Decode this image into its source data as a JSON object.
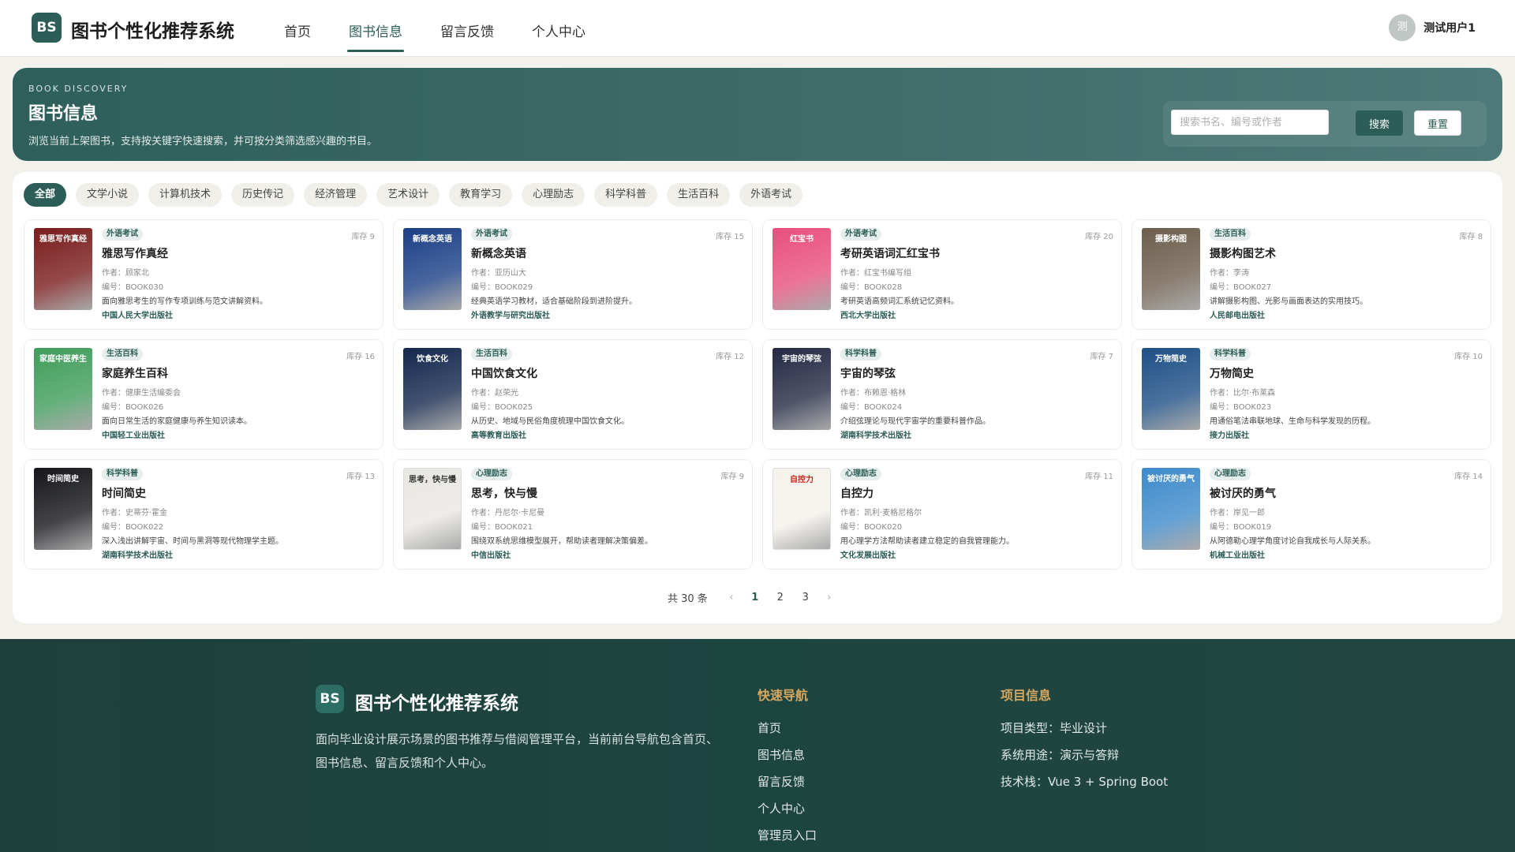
{
  "header": {
    "logo": "BS",
    "brand": "图书个性化推荐系统",
    "nav": [
      "首页",
      "图书信息",
      "留言反馈",
      "个人中心"
    ],
    "active_nav": 1,
    "user_avatar": "测",
    "user_name": "测试用户1"
  },
  "hero": {
    "kicker": "BOOK DISCOVERY",
    "title": "图书信息",
    "desc": "浏览当前上架图书，支持按关键字快速搜索，并可按分类筛选感兴趣的书目。",
    "search_placeholder": "搜索书名、编号或作者",
    "search_label": "搜索",
    "reset_label": "重置"
  },
  "categories": [
    "全部",
    "文学小说",
    "计算机技术",
    "历史传记",
    "经济管理",
    "艺术设计",
    "教育学习",
    "心理励志",
    "科学科普",
    "生活百科",
    "外语考试"
  ],
  "active_category": 0,
  "books": [
    {
      "tag": "外语考试",
      "stock": "库存 9",
      "title": "雅思写作真经",
      "author": "作者：顾家北",
      "code": "编号：BOOK030",
      "desc": "面向雅思考生的写作专项训练与范文讲解资料。",
      "publisher": "中国人民大学出版社",
      "cover_color": "#7a1c1c",
      "cover_text": "雅思写作真经"
    },
    {
      "tag": "外语考试",
      "stock": "库存 15",
      "title": "新概念英语",
      "author": "作者：亚历山大",
      "code": "编号：BOOK029",
      "desc": "经典英语学习教材，适合基础阶段到进阶提升。",
      "publisher": "外语教学与研究出版社",
      "cover_color": "#1b3f86",
      "cover_text": "新概念英语"
    },
    {
      "tag": "外语考试",
      "stock": "库存 20",
      "title": "考研英语词汇红宝书",
      "author": "作者：红宝书编写组",
      "code": "编号：BOOK028",
      "desc": "考研英语高频词汇系统记忆资料。",
      "publisher": "西北大学出版社",
      "cover_color": "#e84f7e",
      "cover_text": "红宝书"
    },
    {
      "tag": "生活百科",
      "stock": "库存 8",
      "title": "摄影构图艺术",
      "author": "作者：李涛",
      "code": "编号：BOOK027",
      "desc": "讲解摄影构图、光影与画面表达的实用技巧。",
      "publisher": "人民邮电出版社",
      "cover_color": "#6d5e4c",
      "cover_text": "摄影构图"
    },
    {
      "tag": "生活百科",
      "stock": "库存 16",
      "title": "家庭养生百科",
      "author": "作者：健康生活编委会",
      "code": "编号：BOOK026",
      "desc": "面向日常生活的家庭健康与养生知识读本。",
      "publisher": "中国轻工业出版社",
      "cover_color": "#3f9d5a",
      "cover_text": "家庭中医养生"
    },
    {
      "tag": "生活百科",
      "stock": "库存 12",
      "title": "中国饮食文化",
      "author": "作者：赵荣光",
      "code": "编号：BOOK025",
      "desc": "从历史、地域与民俗角度梳理中国饮食文化。",
      "publisher": "高等教育出版社",
      "cover_color": "#14284d",
      "cover_text": "饮食文化"
    },
    {
      "tag": "科学科普",
      "stock": "库存 7",
      "title": "宇宙的琴弦",
      "author": "作者：布赖恩·格林",
      "code": "编号：BOOK024",
      "desc": "介绍弦理论与现代宇宙学的重要科普作品。",
      "publisher": "湖南科学技术出版社",
      "cover_color": "#242a44",
      "cover_text": "宇宙的琴弦"
    },
    {
      "tag": "科学科普",
      "stock": "库存 10",
      "title": "万物简史",
      "author": "作者：比尔·布莱森",
      "code": "编号：BOOK023",
      "desc": "用通俗笔法串联地球、生命与科学发现的历程。",
      "publisher": "接力出版社",
      "cover_color": "#1d4f86",
      "cover_text": "万物简史"
    },
    {
      "tag": "科学科普",
      "stock": "库存 13",
      "title": "时间简史",
      "author": "作者：史蒂芬·霍金",
      "code": "编号：BOOK022",
      "desc": "深入浅出讲解宇宙、时间与黑洞等现代物理学主题。",
      "publisher": "湖南科学技术出版社",
      "cover_color": "#15161b",
      "cover_text": "时间简史"
    },
    {
      "tag": "心理励志",
      "stock": "库存 9",
      "title": "思考，快与慢",
      "author": "作者：丹尼尔·卡尼曼",
      "code": "编号：BOOK021",
      "desc": "围绕双系统思维模型展开，帮助读者理解决策偏差。",
      "publisher": "中信出版社",
      "cover_color": "#e9e7e2",
      "cover_text": "思考，快与慢"
    },
    {
      "tag": "心理励志",
      "stock": "库存 11",
      "title": "自控力",
      "author": "作者：凯利·麦格尼格尔",
      "code": "编号：BOOK020",
      "desc": "用心理学方法帮助读者建立稳定的自我管理能力。",
      "publisher": "文化发展出版社",
      "cover_color": "#f5f2ec",
      "cover_text": "自控力"
    },
    {
      "tag": "心理励志",
      "stock": "库存 14",
      "title": "被讨厌的勇气",
      "author": "作者：岸见一郎",
      "code": "编号：BOOK019",
      "desc": "从阿德勒心理学角度讨论自我成长与人际关系。",
      "publisher": "机械工业出版社",
      "cover_color": "#3d8acb",
      "cover_text": "被讨厌的勇气"
    }
  ],
  "pager": {
    "total": "共 30 条",
    "prev": "‹",
    "next": "›",
    "pages": [
      "1",
      "2",
      "3"
    ],
    "active": 0
  },
  "footer": {
    "logo": "BS",
    "brand": "图书个性化推荐系统",
    "desc": "面向毕业设计展示场景的图书推荐与借阅管理平台，当前前台导航包含首页、图书信息、留言反馈和个人中心。",
    "nav_title": "快速导航",
    "nav_links": [
      "首页",
      "图书信息",
      "留言反馈",
      "个人中心",
      "管理员入口"
    ],
    "info_title": "项目信息",
    "info_items": [
      "项目类型：毕业设计",
      "系统用途：演示与答辩",
      "技术栈：Vue 3 + Spring Boot"
    ]
  }
}
